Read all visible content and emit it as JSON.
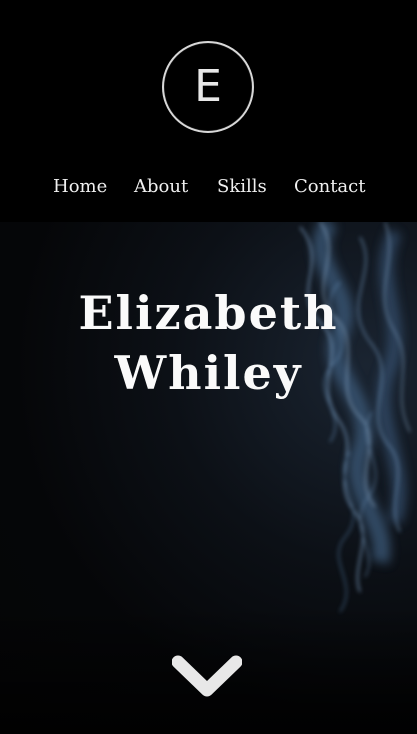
{
  "logo": {
    "letter": "E",
    "icon": "circle-monogram-logo"
  },
  "nav": {
    "items": [
      {
        "label": "Home"
      },
      {
        "label": "About"
      },
      {
        "label": "Skills"
      },
      {
        "label": "Contact"
      }
    ]
  },
  "hero": {
    "name_line1": "Elizabeth",
    "name_line2": "Whiley",
    "background": "smoke-photo",
    "scroll_icon": "chevron-down-icon"
  },
  "colors": {
    "background": "#000000",
    "text": "#f0f0f0",
    "smoke": "#5c7fa6"
  }
}
